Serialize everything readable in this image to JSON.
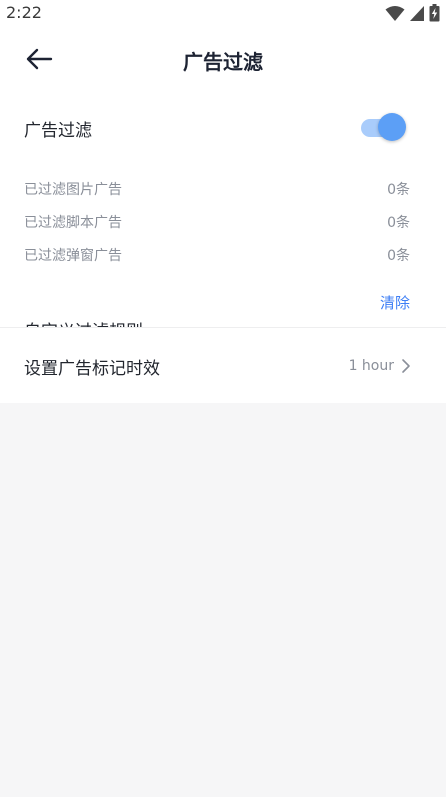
{
  "status_bar": {
    "time": "2:22"
  },
  "header": {
    "title": "广告过滤"
  },
  "ad_filter": {
    "toggle_label": "广告过滤",
    "enabled": true,
    "stats": [
      {
        "label": "已过滤图片广告",
        "count": "0条"
      },
      {
        "label": "已过滤脚本广告",
        "count": "0条"
      },
      {
        "label": "已过滤弹窗广告",
        "count": "0条"
      }
    ],
    "clear_label": "清除"
  },
  "custom_rules": {
    "label": "自定义过滤规则"
  },
  "ad_mark_expiry": {
    "label": "设置广告标记时效",
    "value": "1 hour"
  },
  "colors": {
    "accent": "#3d7ef5",
    "toggle_knob": "#5c9ff6",
    "toggle_track": "#a9ccfb",
    "background": "#f6f6f7"
  }
}
